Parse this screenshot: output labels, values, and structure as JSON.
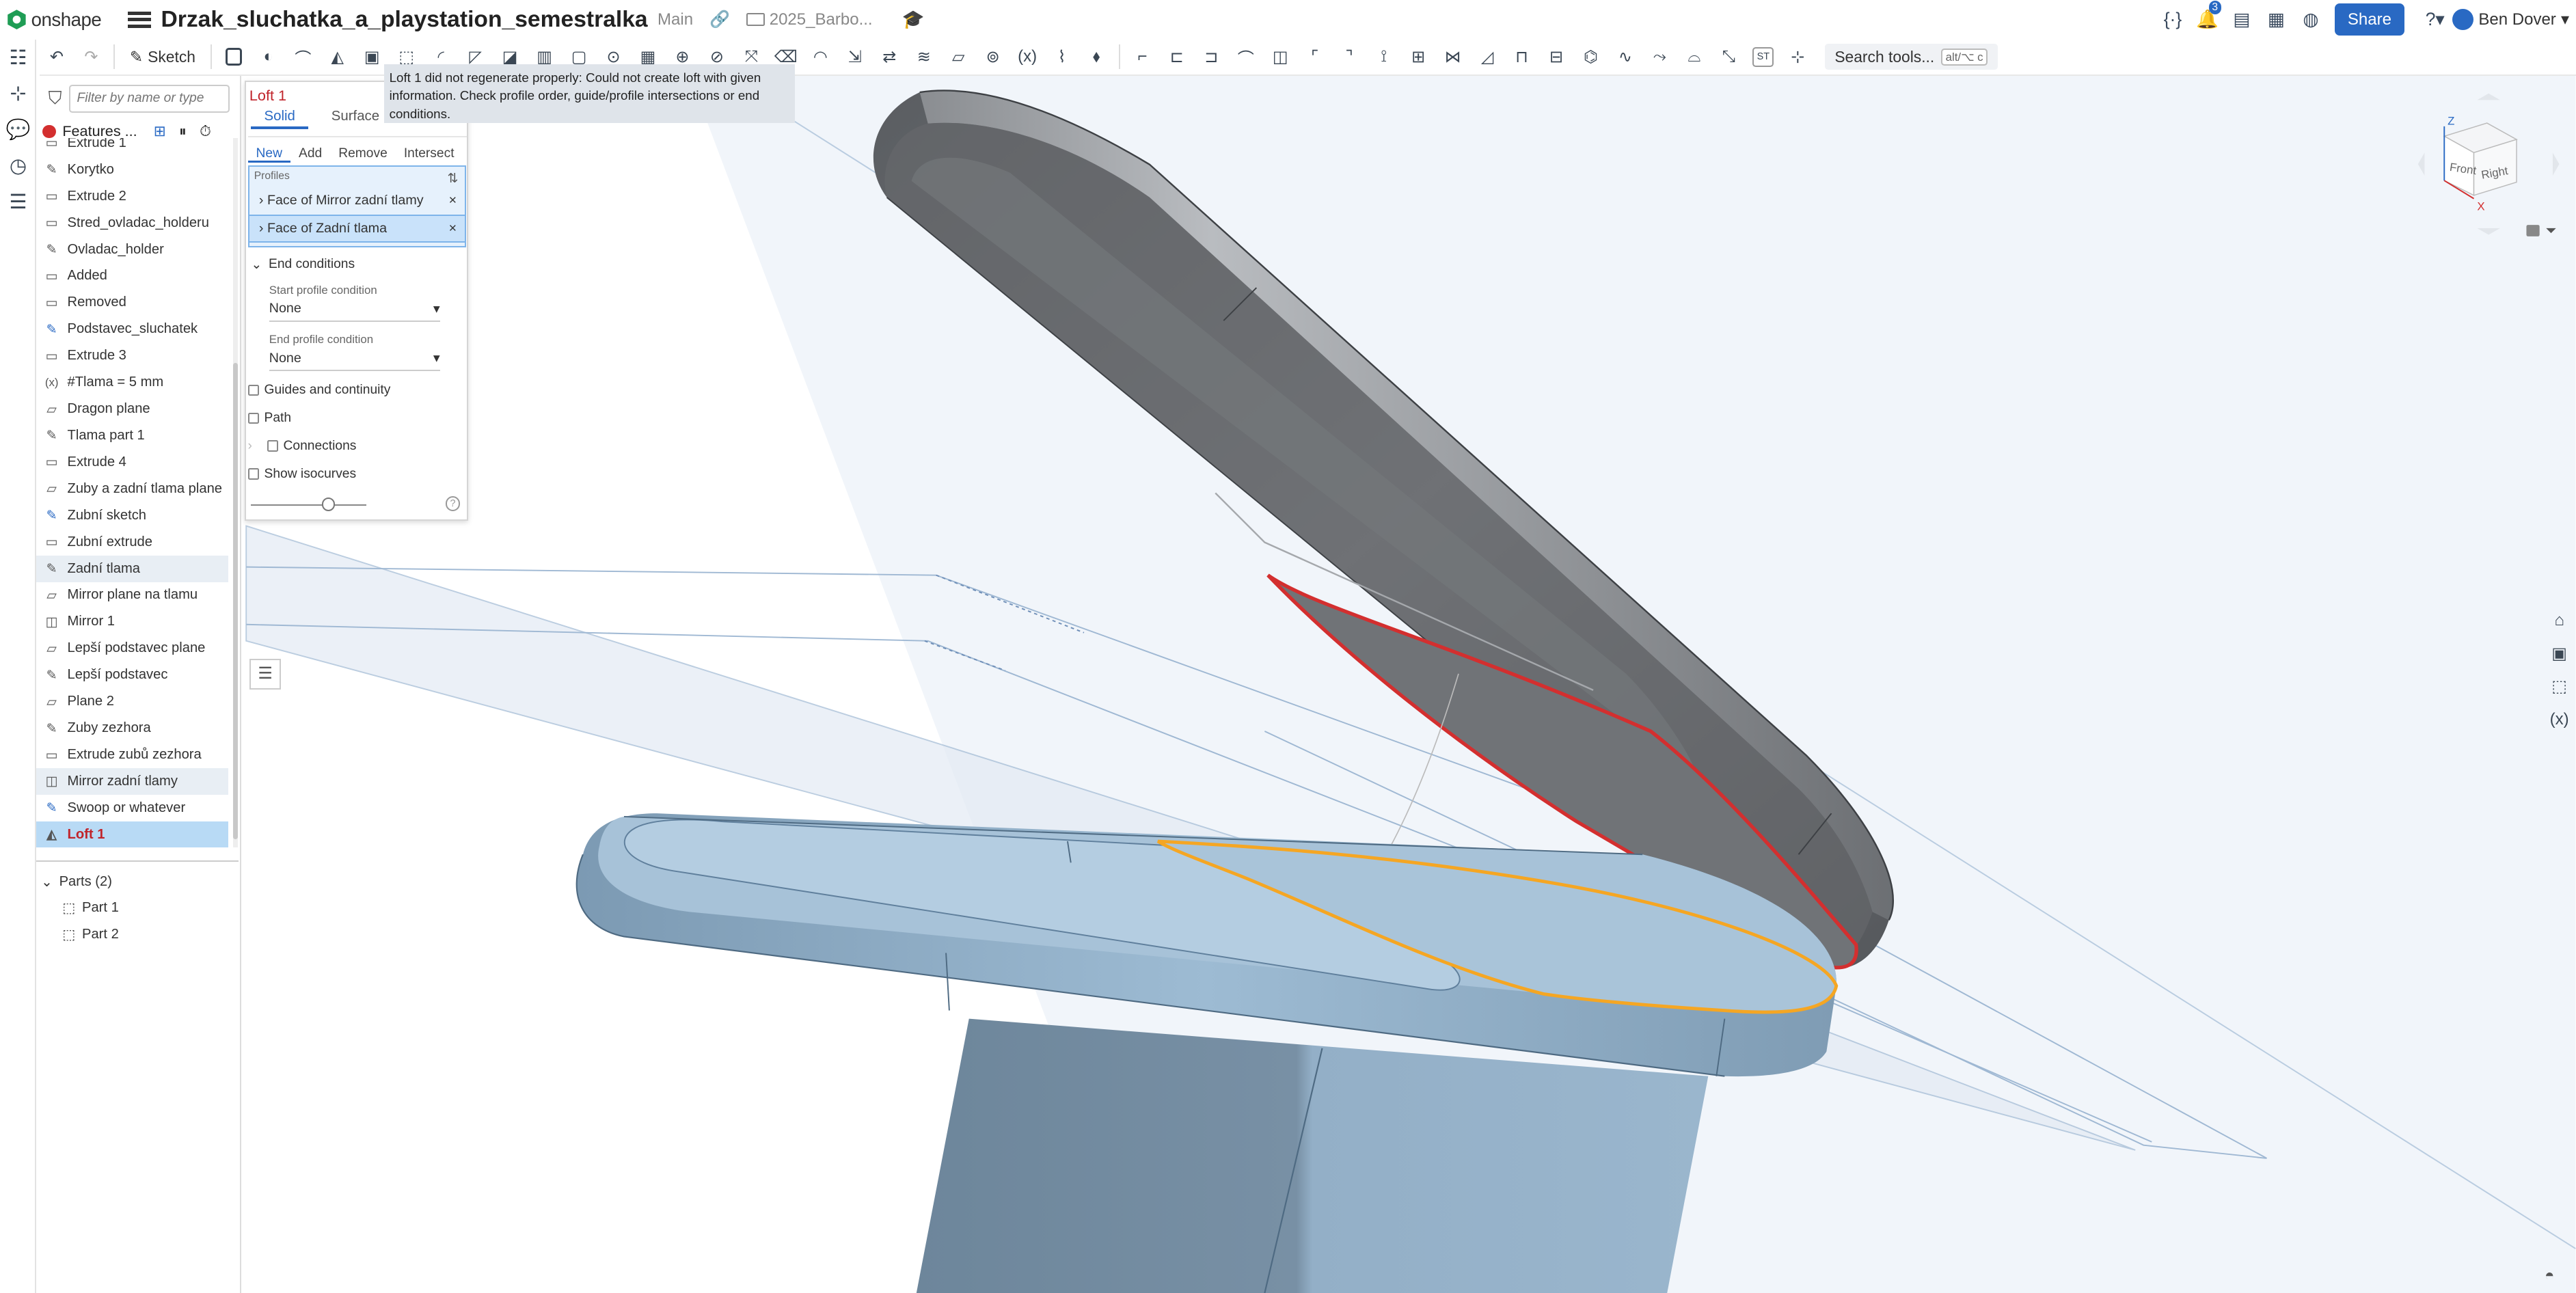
{
  "app": {
    "name": "onshape",
    "brand_color": "#2969c3"
  },
  "document": {
    "title": "Drzak_sluchatka_a_playstation_semestralka",
    "branch": "Main",
    "folder": "2025_Barbo..."
  },
  "topbar": {
    "notifications_count": "3",
    "share_label": "Share",
    "user_name": "Ben Dover"
  },
  "toolbar": {
    "sketch_label": "Sketch",
    "st_label": "ST",
    "search_label": "Search tools...",
    "search_shortcut": "alt/⌥ c"
  },
  "feature_panel": {
    "filter_placeholder": "Filter by name or type",
    "header_label": "Features ...",
    "features": [
      {
        "icon": "extrude",
        "label": "Extrude 1"
      },
      {
        "icon": "sketch",
        "label": "Korytko"
      },
      {
        "icon": "extrude",
        "label": "Extrude 2"
      },
      {
        "icon": "extrude",
        "label": "Stred_ovladac_holderu"
      },
      {
        "icon": "sketch",
        "label": "Ovladac_holder"
      },
      {
        "icon": "extrude",
        "label": "Added"
      },
      {
        "icon": "extrude",
        "label": "Removed"
      },
      {
        "icon": "sketch-blue",
        "label": "Podstavec_sluchatek"
      },
      {
        "icon": "extrude",
        "label": "Extrude 3"
      },
      {
        "icon": "variable",
        "label": "#Tlama = 5 mm"
      },
      {
        "icon": "plane",
        "label": "Dragon plane"
      },
      {
        "icon": "sketch",
        "label": "Tlama part 1"
      },
      {
        "icon": "extrude",
        "label": "Extrude 4"
      },
      {
        "icon": "plane",
        "label": "Zuby a zadní tlama plane"
      },
      {
        "icon": "sketch-blue",
        "label": "Zubní sketch"
      },
      {
        "icon": "extrude",
        "label": "Zubní extrude"
      },
      {
        "icon": "sketch",
        "label": "Zadní tlama"
      },
      {
        "icon": "plane",
        "label": "Mirror plane na tlamu"
      },
      {
        "icon": "mirror",
        "label": "Mirror 1"
      },
      {
        "icon": "plane",
        "label": "Lepší podstavec plane"
      },
      {
        "icon": "sketch",
        "label": "Lepší podstavec"
      },
      {
        "icon": "plane",
        "label": "Plane 2"
      },
      {
        "icon": "sketch",
        "label": "Zuby zezhora"
      },
      {
        "icon": "extrude",
        "label": "Extrude zubů zezhora"
      },
      {
        "icon": "mirror",
        "label": "Mirror zadní tlamy"
      },
      {
        "icon": "sketch-blue",
        "label": "Swoop or whatever"
      },
      {
        "icon": "loft",
        "label": "Loft 1"
      }
    ],
    "parts_header": "Parts (2)",
    "parts": [
      "Part 1",
      "Part 2"
    ]
  },
  "loft_dialog": {
    "title": "Loft 1",
    "tabs": [
      "Solid",
      "Surface"
    ],
    "operations": [
      "New",
      "Add",
      "Remove",
      "Intersect"
    ],
    "profiles_label": "Profiles",
    "profiles": [
      "Face of Mirror zadní tlamy",
      "Face of Zadní tlama"
    ],
    "end_conditions_label": "End conditions",
    "start_condition_label": "Start profile condition",
    "start_condition_value": "None",
    "end_condition_label": "End profile condition",
    "end_condition_value": "None",
    "guides_label": "Guides and continuity",
    "path_label": "Path",
    "connections_label": "Connections",
    "isocurves_label": "Show isocurves"
  },
  "tooltip": {
    "text": "Loft 1 did not regenerate properly: Could not create loft with given information. Check profile order, guide/profile intersections or end conditions."
  },
  "viewcube": {
    "front_label": "Front",
    "right_label": "Right",
    "z_label": "Z",
    "x_label": "X"
  },
  "colors": {
    "error_red": "#c0242b",
    "selection_blue": "#b8daf5",
    "part_grey": "#6b6e72",
    "part_blue": "#8fb1cc",
    "profile_orange": "#f5a623",
    "profile_red": "#d32f2f"
  }
}
